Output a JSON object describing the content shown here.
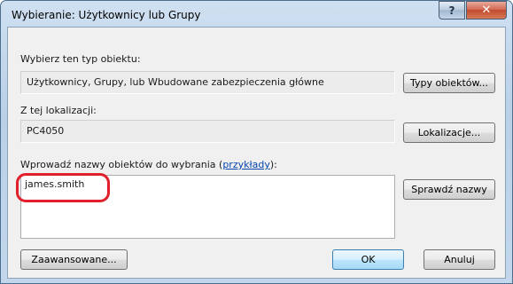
{
  "window": {
    "title": "Wybieranie: Użytkownicy lub Grupy"
  },
  "titlebar": {
    "help_label": "?",
    "close_label": "✕"
  },
  "object_type": {
    "label": "Wybierz ten typ obiektu:",
    "value": "Użytkownicy, Grupy, lub Wbudowane zabezpieczenia główne",
    "button": "Typy obiektów..."
  },
  "location": {
    "label": "Z tej lokalizacji:",
    "value": "PC4050",
    "button": "Lokalizacje..."
  },
  "names": {
    "label_prefix": "Wprowadź nazwy obiektów do wybrania (",
    "examples_link": "przykłady",
    "label_suffix": "):",
    "value": "james.smith",
    "check_button": "Sprawdź nazwy"
  },
  "footer": {
    "advanced_button": "Zaawansowane...",
    "ok_button": "OK",
    "cancel_button": "Anuluj"
  },
  "colors": {
    "highlight": "#e0202a",
    "link": "#0645ad"
  }
}
